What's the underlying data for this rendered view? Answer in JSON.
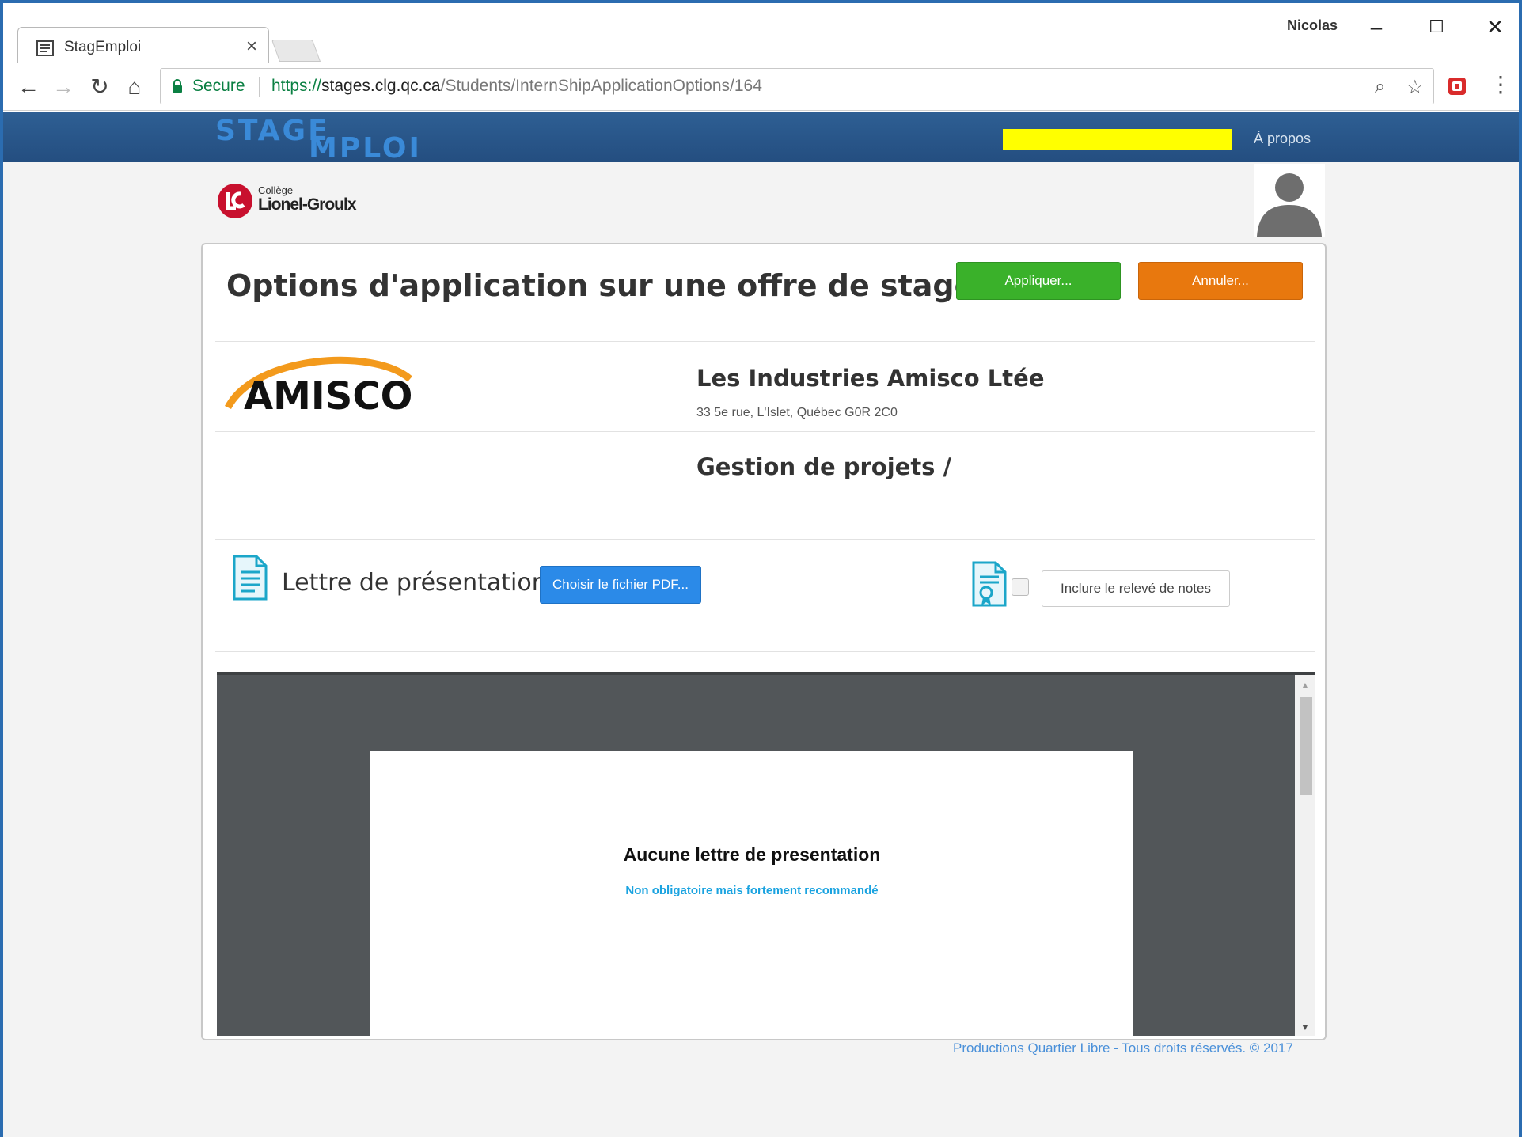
{
  "browser": {
    "tab_title": "StagEmploi",
    "tab_close": "×",
    "user_name": "Nicolas",
    "window_controls": {
      "minimize": "–",
      "maximize": "☐",
      "close": "✕"
    },
    "nav": {
      "back": "←",
      "forward": "→",
      "reload": "↻",
      "home": "⌂"
    },
    "secure_label": "Secure",
    "url_scheme": "https://",
    "url_host": "stages.clg.qc.ca",
    "url_path": "/Students/InternShipApplicationOptions/164",
    "zoom_icon": "⌕",
    "star_icon": "☆",
    "menu_icon": "⋮"
  },
  "site": {
    "logo_line1": "STAGE",
    "logo_line2": "MPLOI",
    "about_link": "À propos",
    "college_small": "Collège",
    "college_name": "Lionel-Groulx"
  },
  "page": {
    "title": "Options d'application sur une offre de stage",
    "apply_button": "Appliquer...",
    "cancel_button": "Annuler...",
    "company_name": "Les Industries Amisco Ltée",
    "company_address": "33 5e rue, L'Islet, Québec G0R 2C0",
    "offer_title": "Gestion de projets /",
    "company_logo_text": "AMISCO",
    "letter_label": "Lettre de présentation",
    "choose_pdf_button": "Choisir le fichier PDF...",
    "transcript_button": "Inclure le relevé de notes",
    "transcript_checked": false,
    "pdf_heading": "Aucune lettre de presentation",
    "pdf_subtext": "Non obligatoire mais fortement recommandé",
    "footer": "Productions Quartier Libre - Tous droits réservés. © 2017"
  },
  "colors": {
    "header_blue": "#2e5f94",
    "apply_green": "#3ab12a",
    "cancel_orange": "#e8780e",
    "choose_blue": "#2b8ae8",
    "redaction_yellow": "#ffff00",
    "pdf_subtext_blue": "#1aa3e0"
  }
}
